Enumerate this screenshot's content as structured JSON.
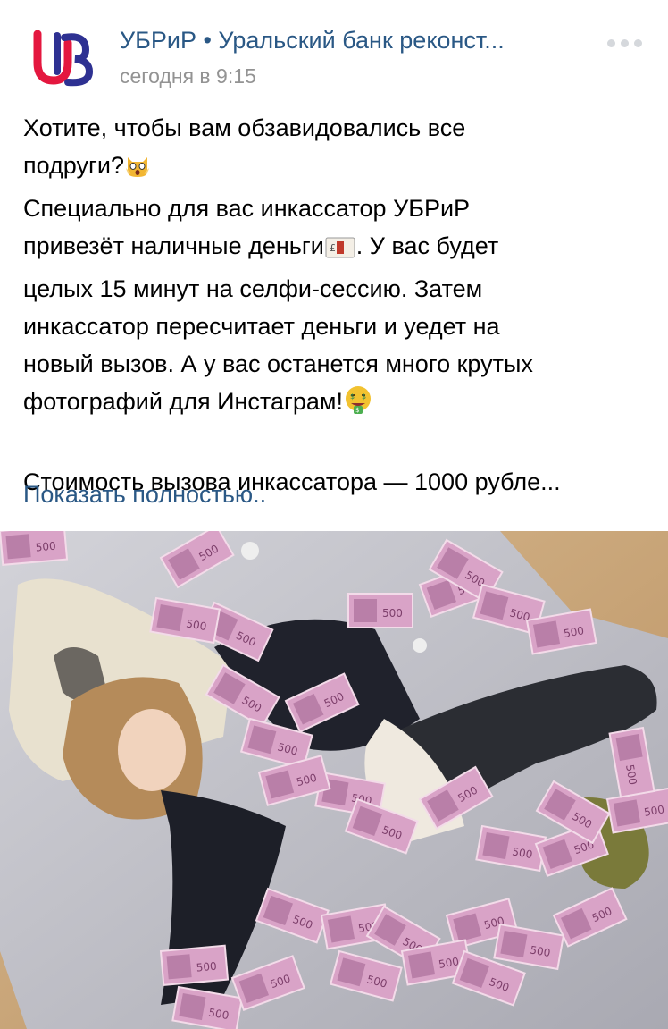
{
  "post": {
    "author": "УБРиР • Уральский банк реконст...",
    "time": "сегодня в 9:15",
    "more_icon": "more-horizontal-icon",
    "text_lines": {
      "l1": "Хотите, чтобы вам обзавидовались все",
      "l2a": "подруги?",
      "l3": "Специально для вас инкассатор УБРиР",
      "l4a": "привезёт наличные деньги",
      "l4b": ". У вас будет",
      "l5": "целых 15 минут на селфи-сессию. Затем",
      "l6": "инкассатор пересчитает деньги и уедет на",
      "l7": "новый вызов. А у вас останется много крутых",
      "l8a": "фотографий для Инстаграм!",
      "l9": "Стоимость вызова инкассатора — 1000 рубле..."
    },
    "emojis": [
      "scream-cat-emoji",
      "money-bag-emoji",
      "money-mouth-face-emoji"
    ],
    "show_more": "Показать полностью..",
    "photo": {
      "banknote_label": "500"
    }
  },
  "colors": {
    "link": "#2a5885",
    "secondary_text": "#939393",
    "logo_red": "#e4173f",
    "logo_blue": "#2e3192",
    "blanket": "#c9c9cf",
    "floor": "#c9a77c",
    "banknote": "#d9a3c7"
  }
}
